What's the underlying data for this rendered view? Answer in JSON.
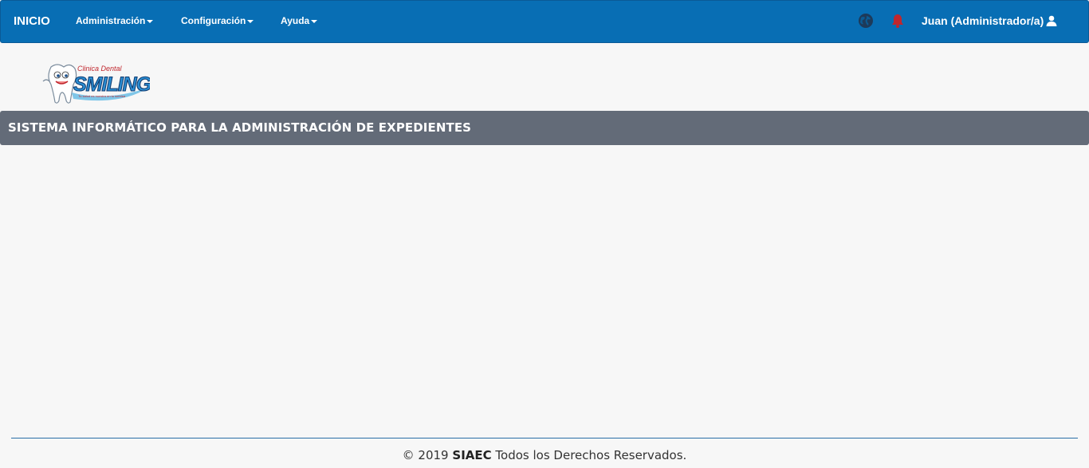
{
  "navbar": {
    "brand": "INICIO",
    "menus": [
      {
        "label": "Administración"
      },
      {
        "label": "Configuración"
      },
      {
        "label": "Ayuda"
      }
    ],
    "user": "Juan (Administrador/a)"
  },
  "logo": {
    "top_text": "Clinica Dental",
    "name": "SMILING",
    "tagline": "Tu salud es nuestra en tu sonrisa"
  },
  "banner": {
    "title": "SISTEMA INFORMÁTICO PARA LA ADMINISTRACIÓN DE EXPEDIENTES"
  },
  "footer": {
    "prefix": "© 2019",
    "brand": "SIAEC",
    "suffix": "Todos los Derechos Reservados."
  },
  "colors": {
    "navbar": "#086eb4",
    "banner": "#636b78",
    "bell": "#c0262d",
    "globe": "#1d3a5a"
  }
}
